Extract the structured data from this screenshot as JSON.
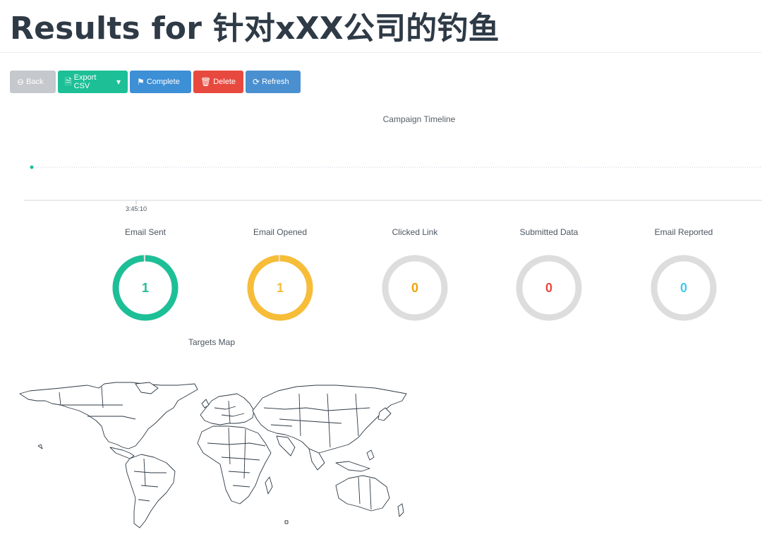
{
  "page": {
    "title": "Results for 针对xXX公司的钓鱼"
  },
  "toolbar": {
    "back_label": "Back",
    "export_label": "Export CSV",
    "complete_label": "Complete",
    "delete_label": "Delete",
    "refresh_label": "Refresh"
  },
  "timeline": {
    "title": "Campaign Timeline",
    "tick_label": "3:45:10",
    "event_color": "#1abc9c"
  },
  "stats": [
    {
      "label": "Email Sent",
      "value": "1",
      "fraction": 0.99,
      "color": "#1dbf97"
    },
    {
      "label": "Email Opened",
      "value": "1",
      "fraction": 0.99,
      "color": "#f7bd38"
    },
    {
      "label": "Clicked Link",
      "value": "0",
      "fraction": 0,
      "color": "#f0a30a"
    },
    {
      "label": "Submitted Data",
      "value": "0",
      "fraction": 0,
      "color": "#e8493f"
    },
    {
      "label": "Email Reported",
      "value": "0",
      "fraction": 0,
      "color": "#45c8f0"
    }
  ],
  "map": {
    "title": "Targets Map"
  },
  "colors": {
    "track_gray": "#dddddd",
    "map_stroke": "#2e3a46"
  }
}
